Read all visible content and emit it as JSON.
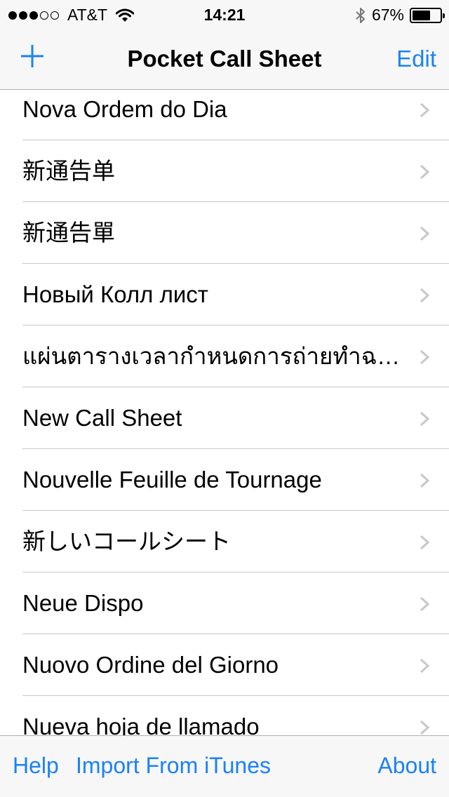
{
  "status_bar": {
    "carrier": "AT&T",
    "time": "14:21",
    "battery": "67%",
    "signal_bars": 3,
    "battery_level": 0.67
  },
  "nav": {
    "title": "Pocket Call Sheet",
    "edit_label": "Edit",
    "add_icon": "plus-icon"
  },
  "list": {
    "items": [
      "Nova Ordem do Dia",
      "新通告单",
      "新通告單",
      "Новый Колл лист",
      "แผ่นตารางเวลากำหนดการถ่ายทำฉบับใหม่",
      "New Call Sheet",
      "Nouvelle Feuille de Tournage",
      "新しいコールシート",
      "Neue Dispo",
      "Nuovo Ordine del Giorno",
      "Nueva hoja de llamado"
    ]
  },
  "toolbar": {
    "help_label": "Help",
    "import_label": "Import From iTunes",
    "about_label": "About"
  },
  "colors": {
    "accent": "#1a82f7",
    "bar_background": "#f7f7f8",
    "separator": "#c8c7cc"
  }
}
